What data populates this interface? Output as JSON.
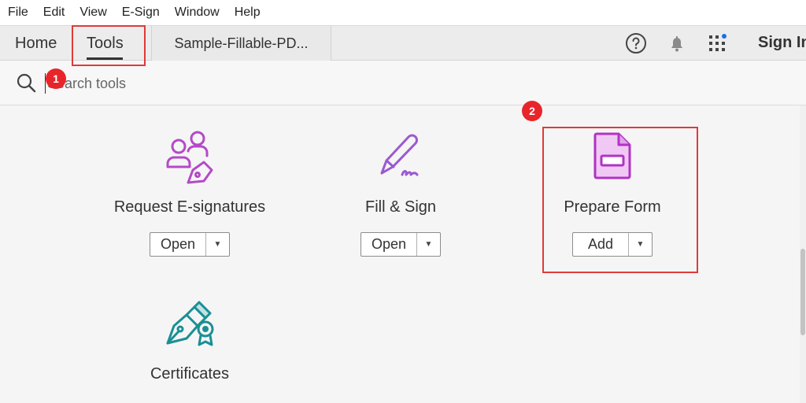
{
  "menu": {
    "items": [
      "File",
      "Edit",
      "View",
      "E-Sign",
      "Window",
      "Help"
    ]
  },
  "tabs": {
    "home": "Home",
    "tools": "Tools",
    "document": "Sample-Fillable-PD..."
  },
  "header": {
    "sign_in": "Sign In"
  },
  "search": {
    "placeholder": "Search tools",
    "value": ""
  },
  "annotations": {
    "step1": "1",
    "step2": "2"
  },
  "tools": [
    {
      "label": "Request E-signatures",
      "action": "Open",
      "icon": "request-esignatures-icon"
    },
    {
      "label": "Fill & Sign",
      "action": "Open",
      "icon": "fill-sign-icon"
    },
    {
      "label": "Prepare Form",
      "action": "Add",
      "icon": "prepare-form-icon"
    },
    {
      "label": "Certificates",
      "action": "",
      "icon": "certificates-icon"
    }
  ],
  "colors": {
    "accent_purple": "#b44ac7",
    "fill_sign_purple": "#9b59d0",
    "certificates_teal": "#1a8f95",
    "annotation_red": "#e8252b"
  }
}
